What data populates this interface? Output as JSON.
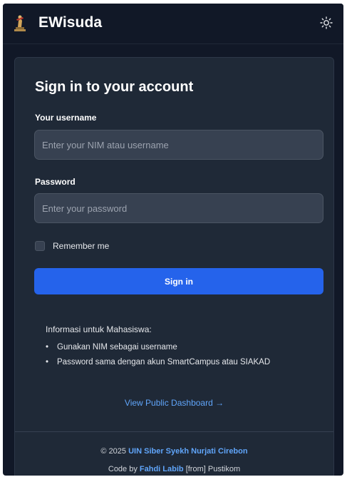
{
  "app": {
    "brand": "EWisuda",
    "logo_icon": "graduation-statue-logo",
    "theme_icon": "sun-icon"
  },
  "login": {
    "title": "Sign in to your account",
    "username_label": "Your username",
    "username_placeholder": "Enter your NIM atau username",
    "username_value": "",
    "password_label": "Password",
    "password_placeholder": "Enter your password",
    "password_value": "",
    "remember_label": "Remember me",
    "remember_checked": false,
    "submit_label": "Sign in"
  },
  "info": {
    "title": "Informasi untuk Mahasiswa:",
    "items": [
      "Gunakan NIM sebagai username",
      "Password sama dengan akun SmartCampus atau SIAKAD"
    ]
  },
  "public_link": "View Public Dashboard →",
  "footer": {
    "copyright_prefix": "© 2025 ",
    "institution": "UIN Siber Syekh Nurjati Cirebon",
    "code_prefix": "Code by ",
    "author": "Fahdi Labib",
    "code_suffix": " [from] Pustikom"
  },
  "colors": {
    "background": "#111827",
    "card": "#1f2937",
    "input": "#374151",
    "primary": "#2563eb",
    "link": "#60a5fa"
  }
}
